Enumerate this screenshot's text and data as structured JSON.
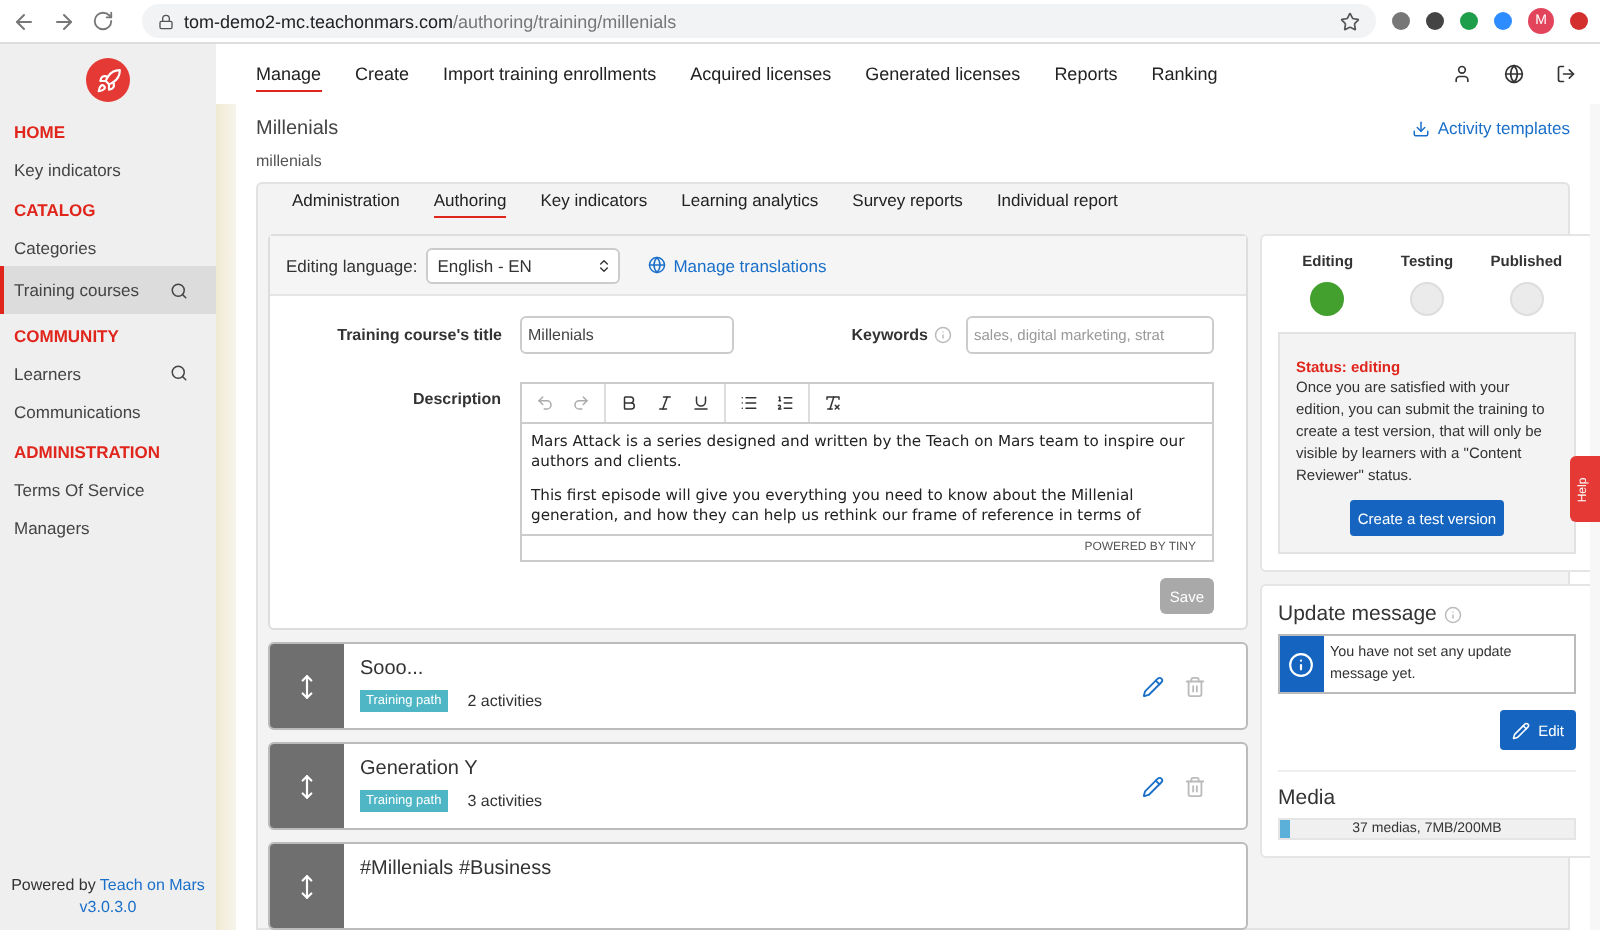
{
  "browser": {
    "url_host": "tom-demo2-mc.teachonmars.com",
    "url_path": "/authoring/training/millenials",
    "avatar": "M"
  },
  "top_nav": [
    {
      "label": "Manage",
      "selected": true
    },
    {
      "label": "Create",
      "selected": false
    },
    {
      "label": "Import training enrollments",
      "selected": false
    },
    {
      "label": "Acquired licenses",
      "selected": false
    },
    {
      "label": "Generated licenses",
      "selected": false
    },
    {
      "label": "Reports",
      "selected": false
    },
    {
      "label": "Ranking",
      "selected": false
    }
  ],
  "sidebar": {
    "sections": [
      {
        "title": "HOME",
        "items": [
          {
            "label": "Key indicators",
            "selected": false,
            "search": false
          }
        ]
      },
      {
        "title": "CATALOG",
        "items": [
          {
            "label": "Categories",
            "selected": false,
            "search": false
          },
          {
            "label": "Training courses",
            "selected": true,
            "search": true
          }
        ]
      },
      {
        "title": "COMMUNITY",
        "items": [
          {
            "label": "Learners",
            "selected": false,
            "search": true
          },
          {
            "label": "Communications",
            "selected": false,
            "search": false
          }
        ]
      },
      {
        "title": "ADMINISTRATION",
        "items": [
          {
            "label": "Terms Of Service",
            "selected": false,
            "search": false
          },
          {
            "label": "Managers",
            "selected": false,
            "search": false
          }
        ]
      }
    ],
    "footer_prefix": "Powered by",
    "footer_link": "Teach on Mars",
    "version": "v3.0.3.0"
  },
  "page": {
    "title": "Millenials",
    "subtitle": "millenials",
    "action": "Activity templates"
  },
  "tabs": [
    {
      "label": "Administration",
      "selected": false
    },
    {
      "label": "Authoring",
      "selected": true
    },
    {
      "label": "Key indicators",
      "selected": false
    },
    {
      "label": "Learning analytics",
      "selected": false
    },
    {
      "label": "Survey reports",
      "selected": false
    },
    {
      "label": "Individual report",
      "selected": false
    }
  ],
  "editor": {
    "language_label": "Editing language:",
    "language": "English - EN",
    "translations": "Manage translations",
    "title_label": "Training course's title",
    "title_value": "Millenials",
    "keywords_label": "Keywords",
    "keywords_placeholder": "sales, digital marketing, strat",
    "description_label": "Description",
    "description": [
      "Mars Attack is a series designed and written by the Teach on Mars team to inspire our authors and clients.",
      "This first episode will give you everything you need to know about the Millenial generation, and how they can help us rethink our frame of reference in terms of"
    ],
    "powered": "POWERED BY TINY",
    "save": "Save",
    "save_disabled": true
  },
  "sections": [
    {
      "title": "Sooo...",
      "tag": "Training path",
      "count": "2 activities"
    },
    {
      "title": "Generation Y",
      "tag": "Training path",
      "count": "3 activities"
    },
    {
      "title": "#Millenials #Business"
    }
  ],
  "stages": [
    {
      "label": "Editing",
      "selected": true
    },
    {
      "label": "Testing",
      "selected": false
    },
    {
      "label": "Published",
      "selected": false
    }
  ],
  "status": {
    "title": "Status: editing",
    "text": "Once you are satisfied with your edition, you can submit the training to create a test version, that will only be visible by learners with a \"Content Reviewer\" status.",
    "button": "Create a test version"
  },
  "update_message": {
    "title": "Update message",
    "text": "You have not set any update message yet.",
    "button": "Edit"
  },
  "media": {
    "title": "Media",
    "reading": "37 medias, 7MB/200MB",
    "level": 0.035
  },
  "help_tab": "Help"
}
